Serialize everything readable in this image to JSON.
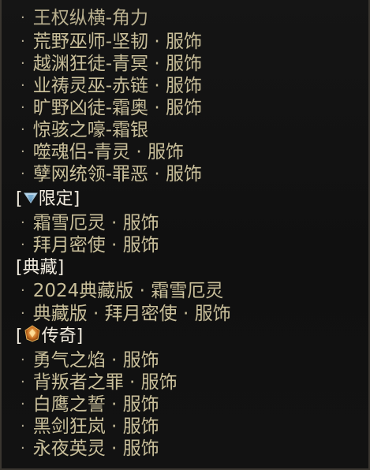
{
  "items": [
    {
      "bullet": "·",
      "label": "王权纵横-角力"
    },
    {
      "bullet": "·",
      "label": "荒野巫师-坚韧 · 服饰"
    },
    {
      "bullet": "·",
      "label": "越渊狂徒-青冥 · 服饰"
    },
    {
      "bullet": "·",
      "label": "业祷灵巫-赤链 · 服饰"
    },
    {
      "bullet": "·",
      "label": "旷野凶徒-霜奥 · 服饰"
    },
    {
      "bullet": "·",
      "label": "惊骇之嚎-霜银"
    },
    {
      "bullet": "·",
      "label": "噬魂侣-青灵 · 服饰"
    },
    {
      "bullet": "·",
      "label": "孽网统领-罪恶 · 服饰"
    }
  ],
  "sections": [
    {
      "open": "[",
      "label": "限定",
      "close": "]",
      "icon": "triangle-gem-icon",
      "items": [
        {
          "bullet": "·",
          "label": "霜雪厄灵 · 服饰"
        },
        {
          "bullet": "·",
          "label": "拜月密使 · 服饰"
        }
      ]
    },
    {
      "open": "[",
      "label": "典藏",
      "close": "]",
      "items": [
        {
          "bullet": "·",
          "label": "2024典藏版 · 霜雪厄灵"
        },
        {
          "bullet": "·",
          "label": "典藏版 · 拜月密使 · 服饰"
        }
      ]
    },
    {
      "open": "[",
      "label": "传奇",
      "close": "]",
      "icon": "legendary-gem-icon",
      "items": [
        {
          "bullet": "·",
          "label": "勇气之焰 · 服饰"
        },
        {
          "bullet": "·",
          "label": "背叛者之罪 · 服饰"
        },
        {
          "bullet": "·",
          "label": "白鹰之誓 · 服饰"
        },
        {
          "bullet": "·",
          "label": "黑剑狂岚 · 服饰"
        },
        {
          "bullet": "·",
          "label": "永夜英灵 · 服饰"
        }
      ]
    }
  ],
  "colors": {
    "text": "#c9bf9a",
    "header": "#f2ecdf",
    "background": "#121212"
  }
}
